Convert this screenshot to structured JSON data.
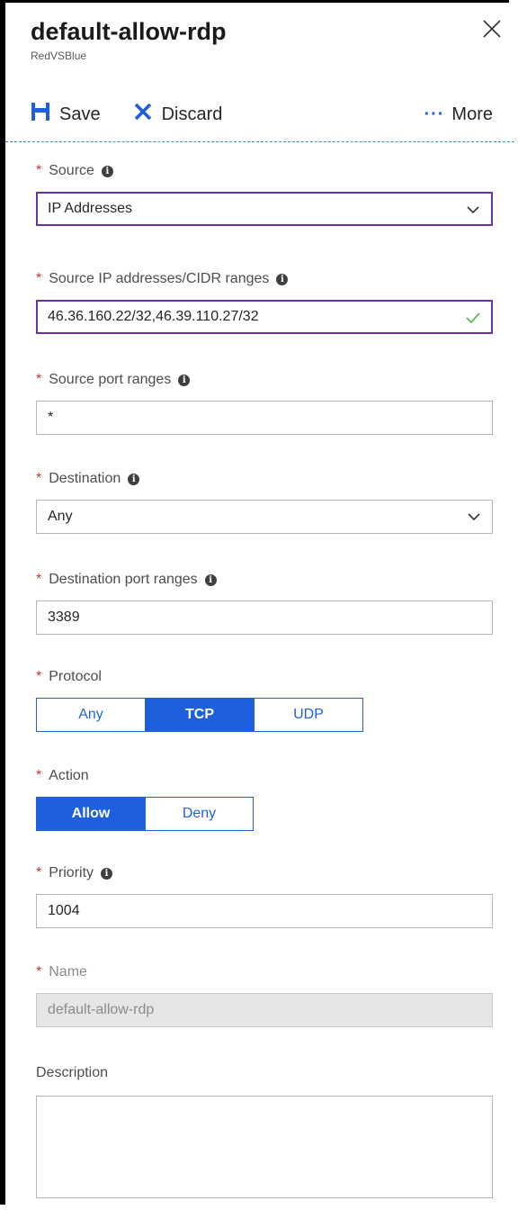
{
  "header": {
    "title": "default-allow-rdp",
    "subtitle": "RedVSBlue"
  },
  "toolbar": {
    "save_label": "Save",
    "discard_label": "Discard",
    "more_label": "More",
    "more_glyph": "···"
  },
  "required_marker": "*",
  "info_glyph": "i",
  "form": {
    "source": {
      "label": "Source",
      "value": "IP Addresses"
    },
    "source_ips": {
      "label": "Source IP addresses/CIDR ranges",
      "value": "46.36.160.22/32,46.39.110.27/32"
    },
    "source_ports": {
      "label": "Source port ranges",
      "value": "*"
    },
    "destination": {
      "label": "Destination",
      "value": "Any"
    },
    "destination_ports": {
      "label": "Destination port ranges",
      "value": "3389"
    },
    "protocol": {
      "label": "Protocol",
      "options": [
        "Any",
        "TCP",
        "UDP"
      ],
      "selected": "TCP"
    },
    "action": {
      "label": "Action",
      "options": [
        "Allow",
        "Deny"
      ],
      "selected": "Allow"
    },
    "priority": {
      "label": "Priority",
      "value": "1004"
    },
    "name": {
      "label": "Name",
      "value": "default-allow-rdp"
    },
    "description": {
      "label": "Description",
      "value": ""
    }
  },
  "colors": {
    "accent": "#1d5fdc",
    "focus_border": "#6b2fa8",
    "required": "#c0392b",
    "valid_check": "#5cb85c",
    "divider": "#2b8fd6"
  },
  "icons": {
    "close": "close-icon",
    "save": "save-icon",
    "discard": "discard-x-icon",
    "more": "ellipsis-icon",
    "info": "info-icon",
    "dropdown": "chevron-down-icon",
    "valid": "checkmark-icon"
  }
}
